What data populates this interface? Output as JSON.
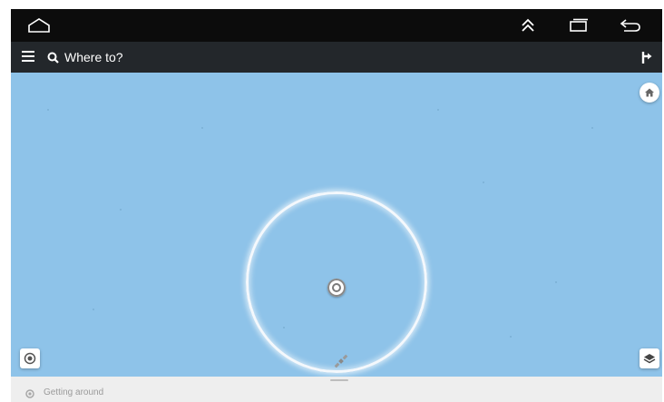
{
  "system_bar": {
    "icons": [
      "home-outline-icon",
      "double-chevron-up-icon",
      "recent-apps-icon",
      "back-arrow-icon"
    ],
    "background": "#0c0c0c"
  },
  "toolbar": {
    "menu_icon": "hamburger-menu-icon",
    "search_icon": "search-icon",
    "search_placeholder": "Where to?",
    "route_icon": "directions-icon",
    "background": "#23272b"
  },
  "map": {
    "background": "#8ec3e9",
    "controls": {
      "home_icon": "home-icon",
      "locate_icon": "my-location-icon",
      "layers_icon": "layers-icon",
      "gps_icon": "satellite-icon"
    }
  },
  "bottom_sheet": {
    "status_icon": "location-pin-icon",
    "status_text": "Getting around"
  }
}
